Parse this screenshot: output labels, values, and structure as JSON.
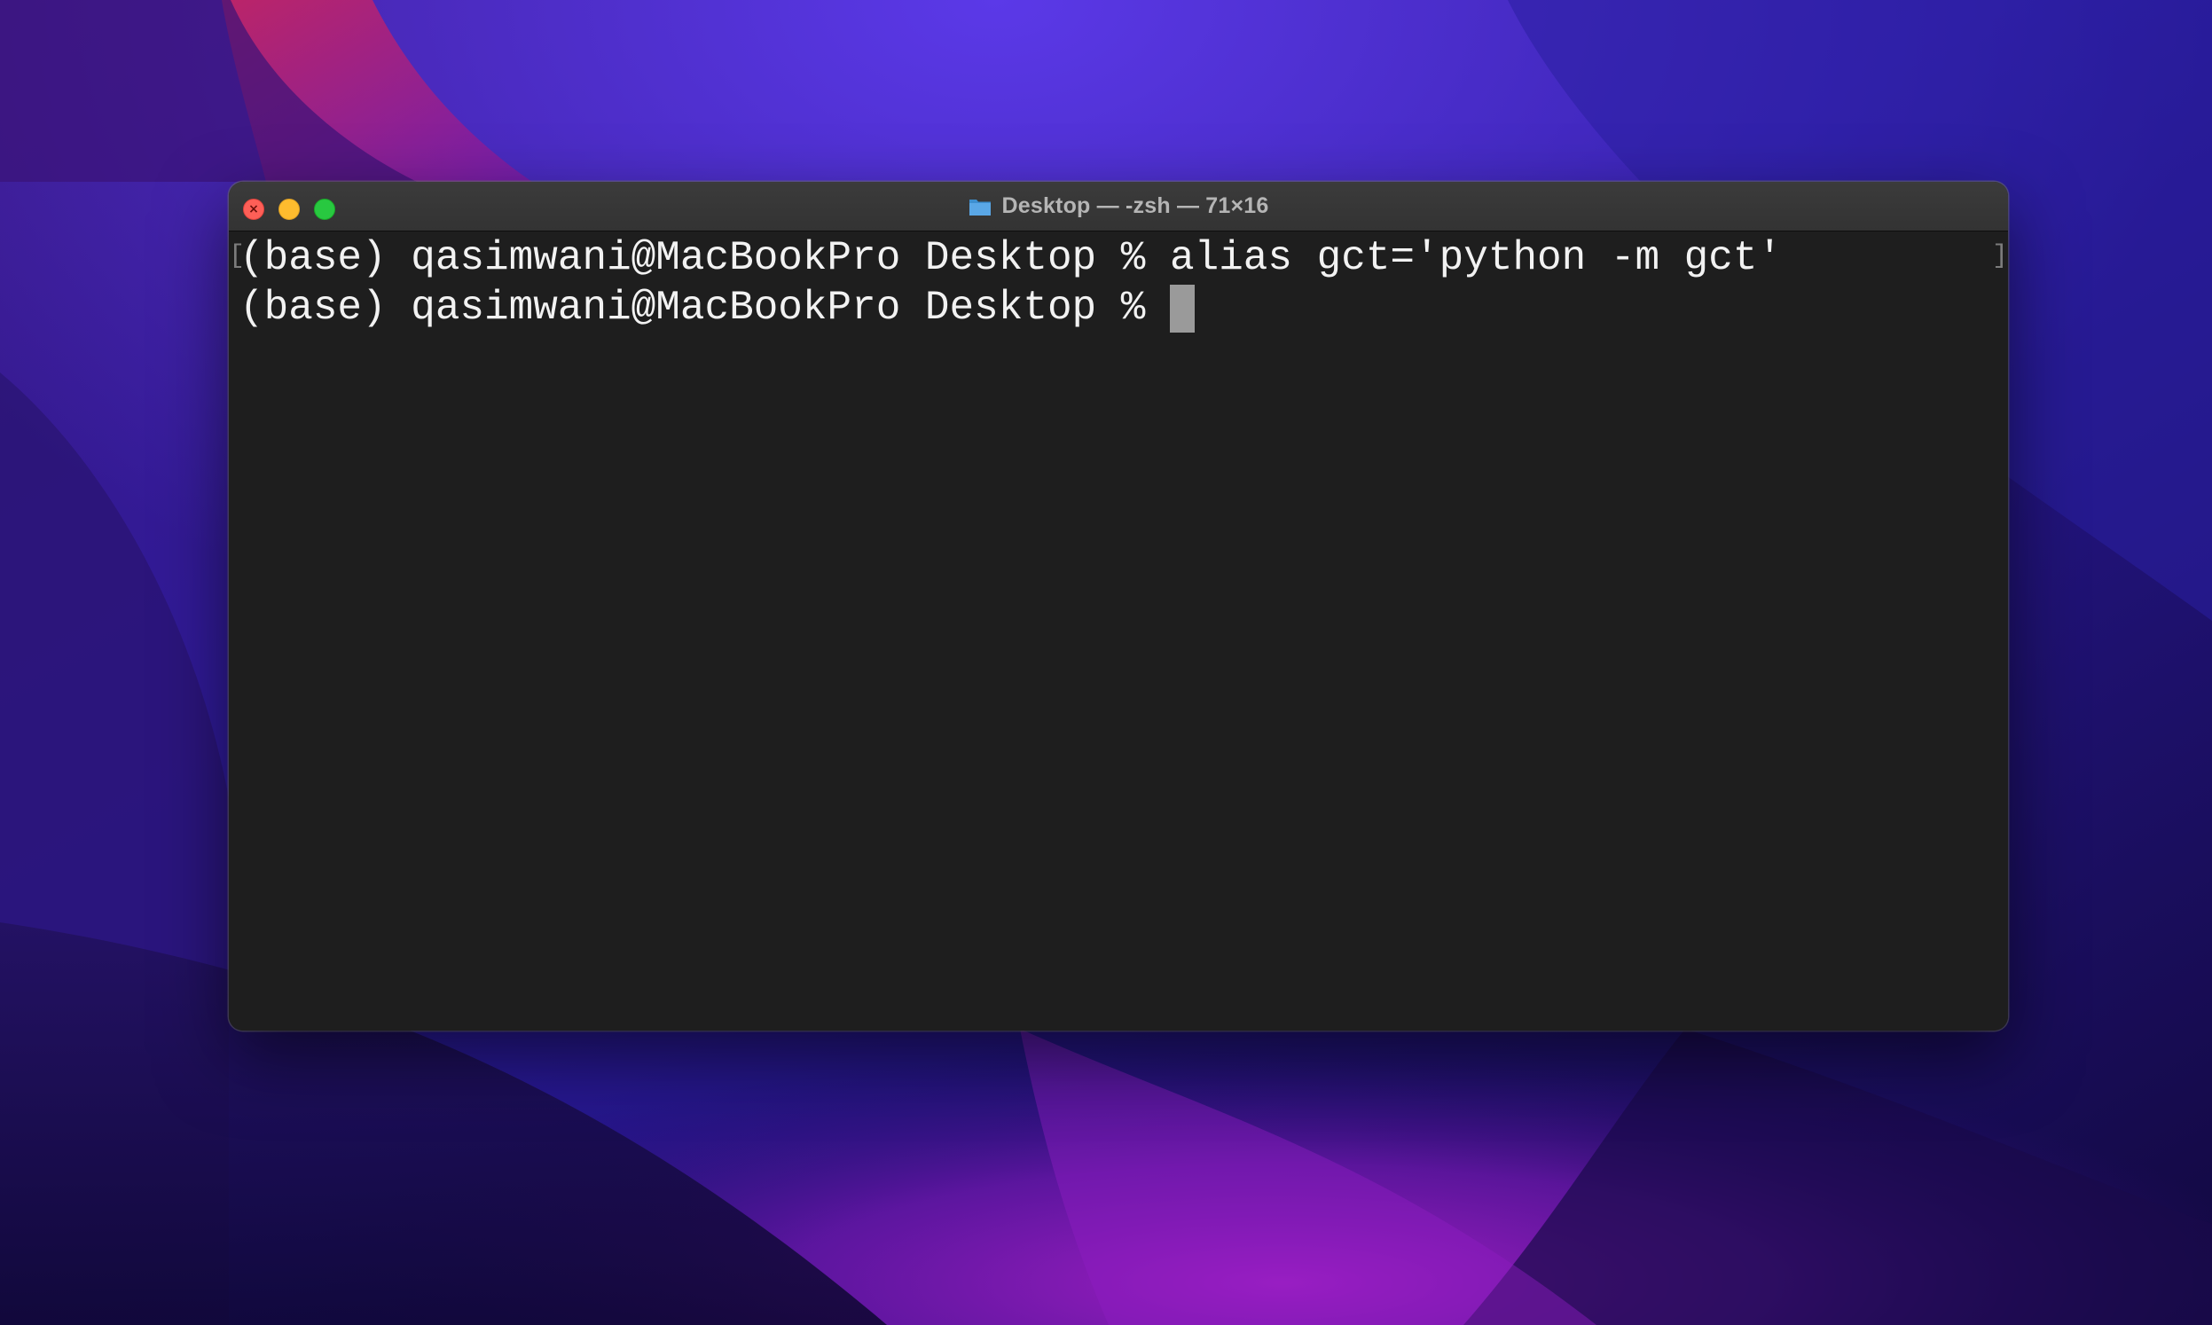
{
  "window": {
    "title": "Desktop — -zsh — 71×16",
    "title_icon": "folder-icon",
    "controls": {
      "close_icon": "close-icon",
      "minimize_icon": "minimize-icon",
      "zoom_icon": "zoom-icon"
    }
  },
  "terminal": {
    "lines": [
      {
        "prompt": "(base) qasimwani@MacBookPro Desktop % ",
        "command": "alias gct='python -m gct'"
      },
      {
        "prompt": "(base) qasimwani@MacBookPro Desktop % ",
        "command": ""
      }
    ],
    "mark_left": "[",
    "mark_right": "]",
    "colors": {
      "background": "#1e1e1e",
      "text": "#f2f2f2",
      "cursor": "#9a9a9a"
    }
  },
  "desktop": {
    "wallpaper": "macOS Monterey purple",
    "colors": {
      "deep_blue": "#1a0f52",
      "violet": "#5a1fd1",
      "magenta": "#8e1bb8",
      "pink": "#c2246a"
    }
  }
}
